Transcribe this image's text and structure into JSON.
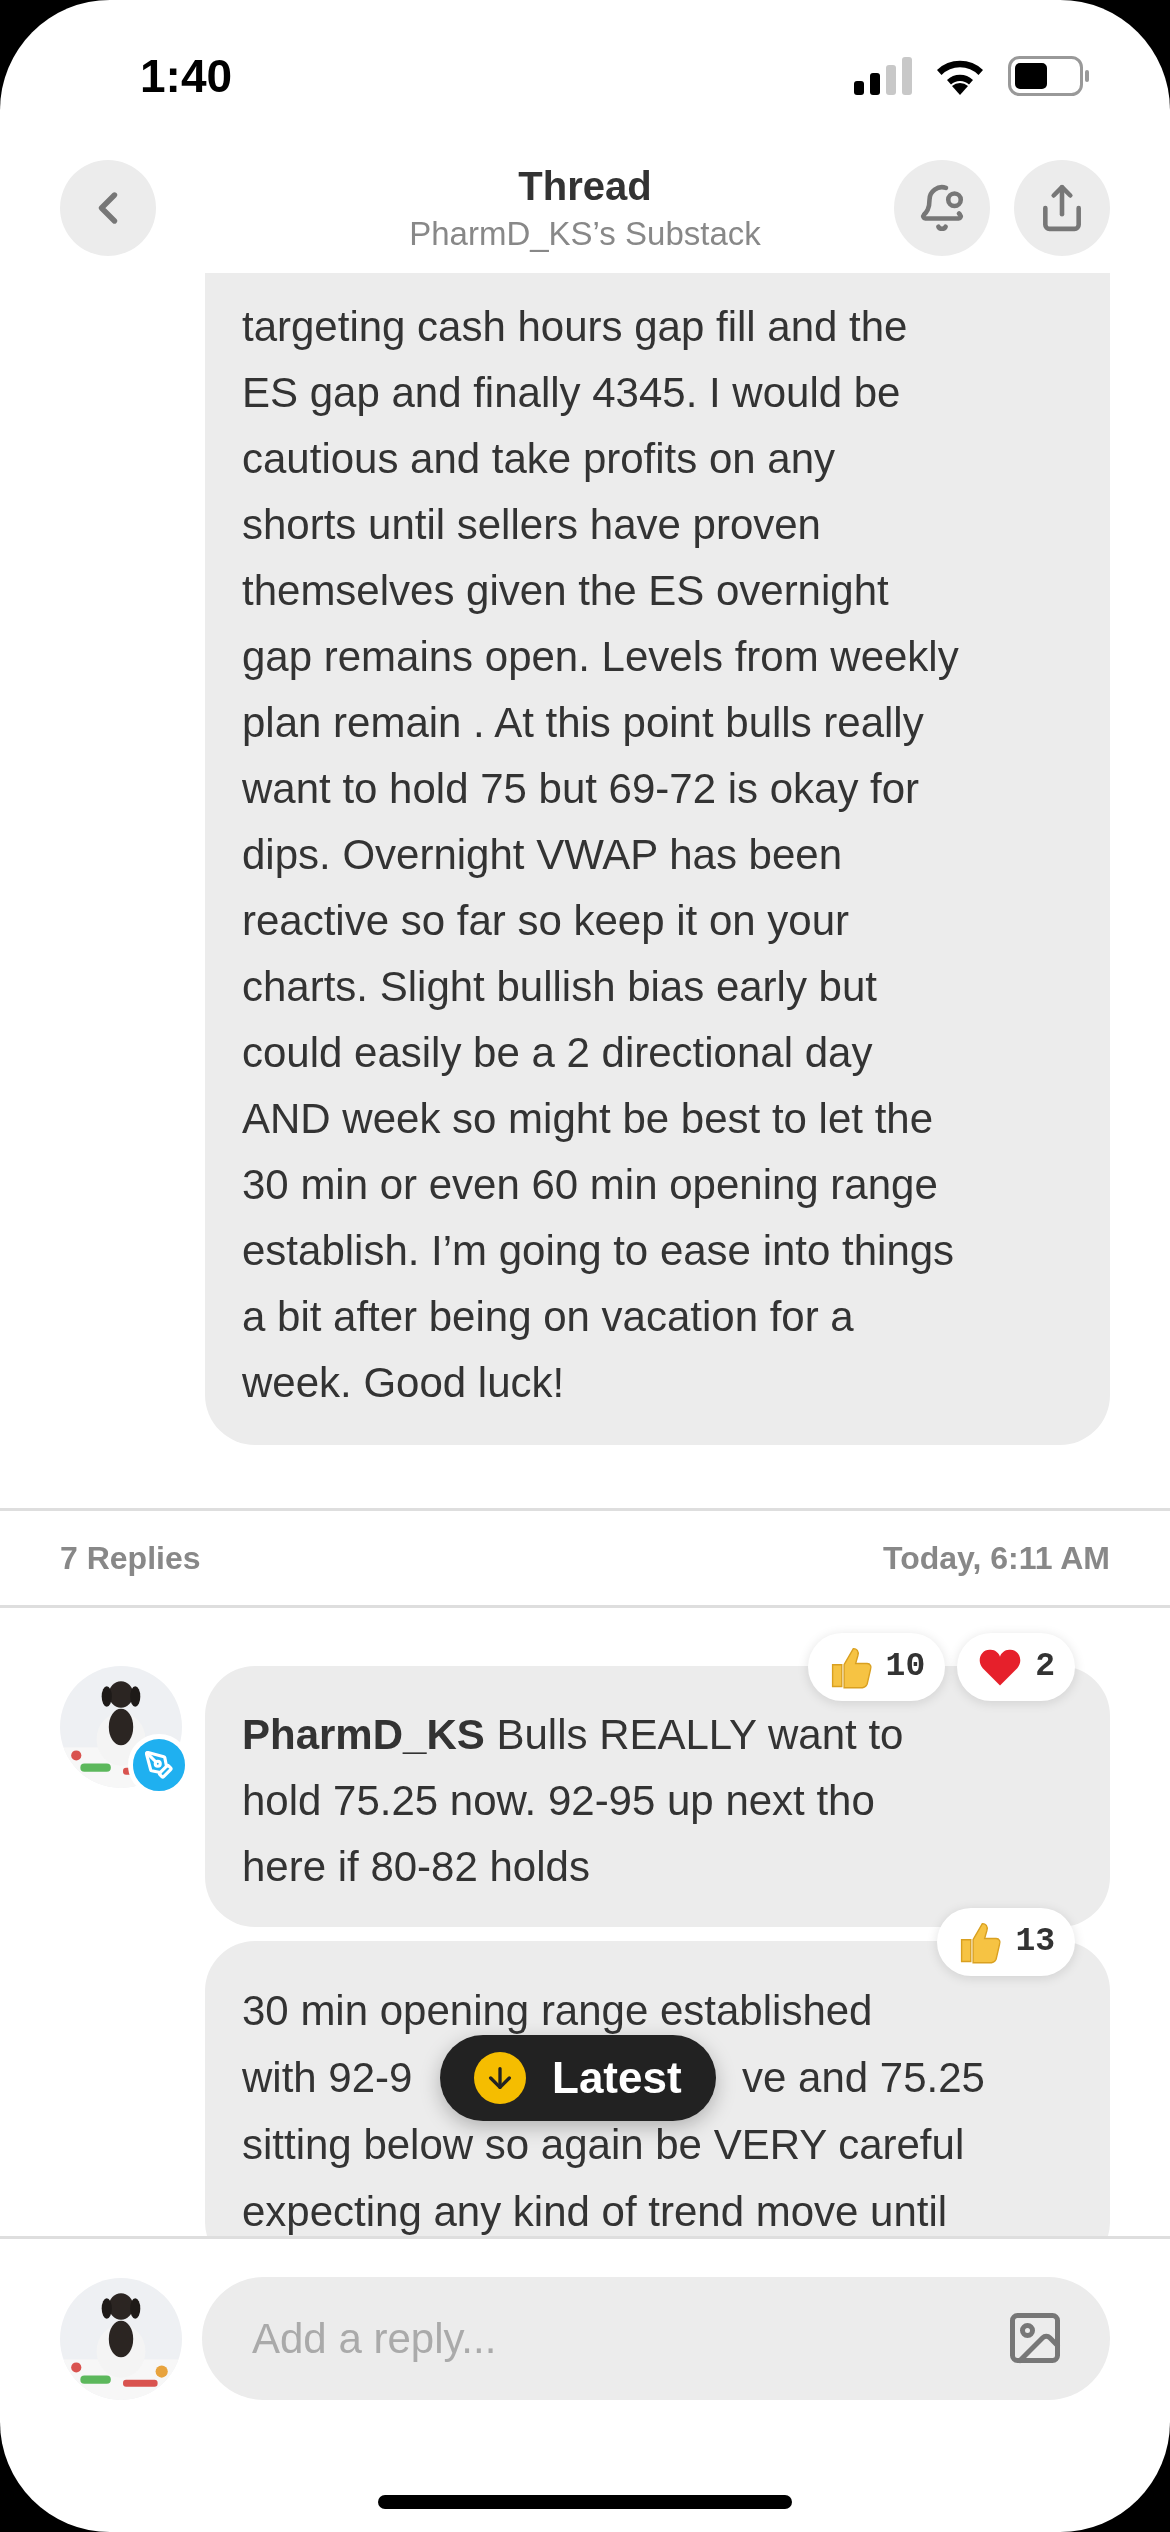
{
  "status_bar": {
    "time": "1:40"
  },
  "header": {
    "title": "Thread",
    "subtitle": "PharmD_KS’s Substack"
  },
  "post": {
    "lines": [
      "targeting cash hours gap fill and the",
      "ES gap and finally 4345. I would be",
      "cautious and take profits on any",
      "shorts until sellers have proven",
      "themselves given the ES overnight",
      "gap remains open. Levels from weekly",
      "plan remain . At this point bulls really",
      "want to hold 75 but 69-72 is okay for",
      "dips. Overnight VWAP has been",
      "reactive so far so keep it on your",
      "charts. Slight bullish bias early but",
      "could easily be a 2 directional day",
      "AND week so might be best to let the",
      "30 min or even 60 min opening range",
      "establish. I’m going to ease into things",
      "a bit after being on vacation for a",
      "week. Good luck!"
    ]
  },
  "replies_bar": {
    "count": "7 Replies",
    "time": "Today, 6:11 AM"
  },
  "replies": [
    {
      "author": "PharmD_KS",
      "show_avatar": true,
      "lines": [
        "Bulls REALLY want to",
        "hold 75.25 now. 92-95 up next tho",
        "here if 80-82 holds"
      ],
      "reactions": [
        {
          "kind": "thumbs",
          "count": "10"
        },
        {
          "kind": "heart",
          "count": "2"
        }
      ]
    },
    {
      "show_avatar": false,
      "lines": [
        [
          "30 min opening range established"
        ],
        [
          "with 92-9",
          "ve and 75.25"
        ],
        [
          "sitting below so again be VERY careful"
        ],
        [
          "expecting any kind of trend move until"
        ]
      ],
      "reactions": [
        {
          "kind": "thumbs",
          "count": "13"
        }
      ]
    }
  ],
  "latest_button": {
    "label": "Latest"
  },
  "composer": {
    "placeholder": "Add a reply..."
  }
}
